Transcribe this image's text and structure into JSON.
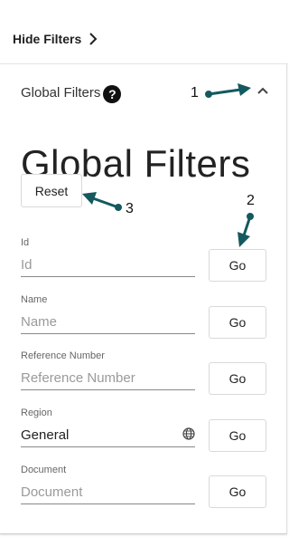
{
  "toolbar": {
    "hide_filters_label": "Hide Filters"
  },
  "panel": {
    "header_label": "Global Filters",
    "help_icon_glyph": "?",
    "title": "Global Filters",
    "reset_label": "Reset"
  },
  "fields": [
    {
      "label": "Id",
      "placeholder": "Id",
      "value": "",
      "go_label": "Go"
    },
    {
      "label": "Name",
      "placeholder": "Name",
      "value": "",
      "go_label": "Go"
    },
    {
      "label": "Reference Number",
      "placeholder": "Reference Number",
      "value": "",
      "go_label": "Go"
    },
    {
      "label": "Region",
      "placeholder": "",
      "value": "General",
      "go_label": "Go"
    },
    {
      "label": "Document",
      "placeholder": "Document",
      "value": "",
      "go_label": "Go"
    }
  ],
  "annotations": [
    "1",
    "2",
    "3"
  ],
  "icons": {
    "hide_filters": "chevron-right-icon",
    "collapse": "chevron-up-icon",
    "help": "help-icon",
    "region": "globe-icon"
  },
  "colors": {
    "annotation_arrow": "#14595f",
    "text": "#212121",
    "placeholder": "#9a9a9a"
  }
}
